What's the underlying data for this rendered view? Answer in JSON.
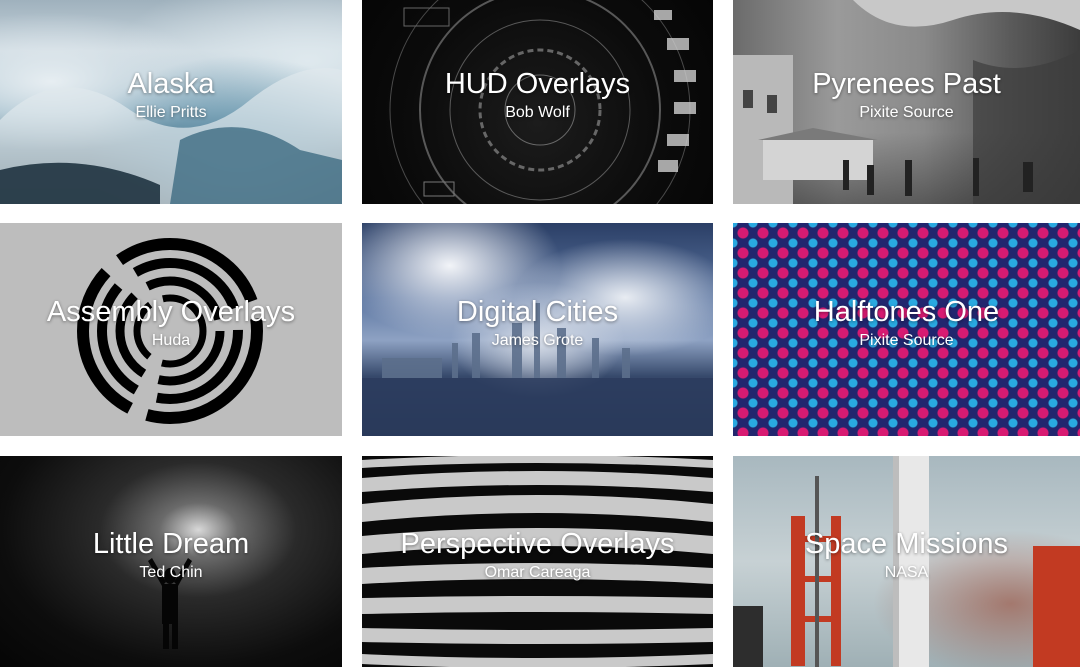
{
  "collections": [
    {
      "title": "Alaska",
      "author": "Ellie Pritts"
    },
    {
      "title": "HUD Overlays",
      "author": "Bob Wolf"
    },
    {
      "title": "Pyrenees Past",
      "author": "Pixite Source"
    },
    {
      "title": "Assembly Overlays",
      "author": "Huda"
    },
    {
      "title": "Digital Cities",
      "author": "James Grote"
    },
    {
      "title": "Halftones One",
      "author": "Pixite Source"
    },
    {
      "title": "Little Dream",
      "author": "Ted Chin"
    },
    {
      "title": "Perspective Overlays",
      "author": "Omar Careaga"
    },
    {
      "title": "Space Missions",
      "author": "NASA"
    }
  ]
}
